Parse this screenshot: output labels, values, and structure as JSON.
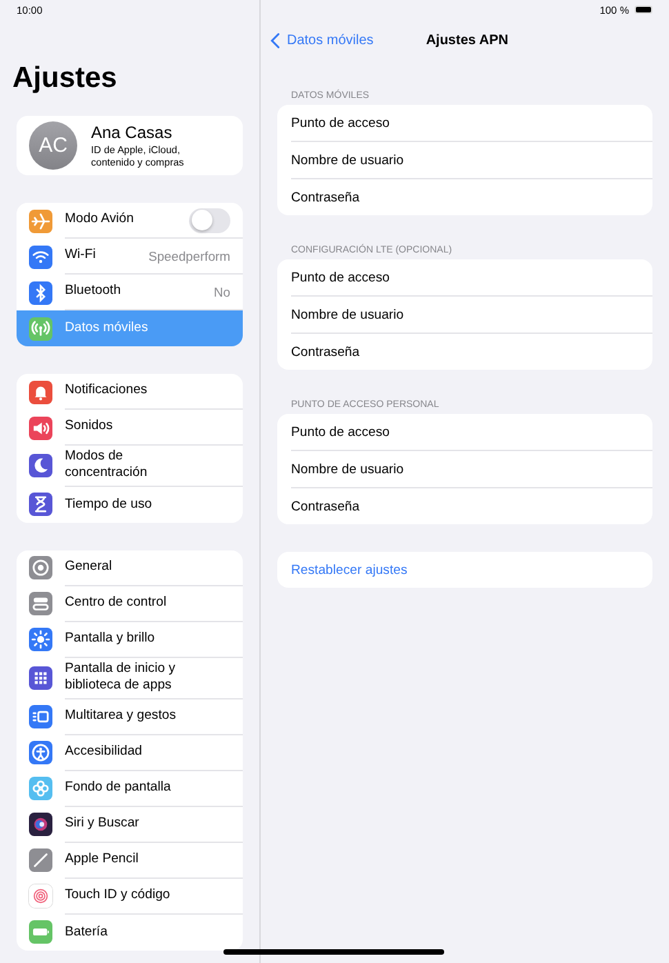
{
  "status_bar": {
    "time": "10:00",
    "battery": "100 %"
  },
  "sidebar": {
    "title": "Ajustes",
    "profile": {
      "initials": "AC",
      "name": "Ana Casas",
      "subtitle": "ID de Apple, iCloud, contenido y compras"
    },
    "groups": [
      [
        {
          "label": "Modo Avión",
          "kind": "toggle",
          "on": false,
          "selected": false
        },
        {
          "label": "Wi-Fi",
          "kind": "value",
          "value": "Speedperform",
          "selected": false
        },
        {
          "label": "Bluetooth",
          "kind": "value",
          "value": "No",
          "selected": false
        },
        {
          "label": "Datos móviles",
          "kind": "plain",
          "selected": true
        }
      ],
      [
        {
          "label": "Notificaciones",
          "kind": "plain",
          "selected": false
        },
        {
          "label": "Sonidos",
          "kind": "plain",
          "selected": false
        },
        {
          "label": "Modos de concentración",
          "kind": "plain",
          "selected": false
        },
        {
          "label": "Tiempo de uso",
          "kind": "plain",
          "selected": false
        }
      ],
      [
        {
          "label": "General",
          "kind": "plain",
          "selected": false
        },
        {
          "label": "Centro de control",
          "kind": "plain",
          "selected": false
        },
        {
          "label": "Pantalla y brillo",
          "kind": "plain",
          "selected": false
        },
        {
          "label": "Pantalla de inicio y biblioteca de apps",
          "kind": "plain",
          "selected": false
        },
        {
          "label": "Multitarea y gestos",
          "kind": "plain",
          "selected": false
        },
        {
          "label": "Accesibilidad",
          "kind": "plain",
          "selected": false
        },
        {
          "label": "Fondo de pantalla",
          "kind": "plain",
          "selected": false
        },
        {
          "label": "Siri y Buscar",
          "kind": "plain",
          "selected": false
        },
        {
          "label": "Apple Pencil",
          "kind": "plain",
          "selected": false
        },
        {
          "label": "Touch ID y código",
          "kind": "plain",
          "selected": false
        },
        {
          "label": "Batería",
          "kind": "plain",
          "selected": false
        }
      ]
    ]
  },
  "detail": {
    "back": "Datos móviles",
    "title": "Ajustes APN",
    "sections": [
      {
        "header": "DATOS MÓVILES",
        "rows": [
          "Punto de acceso",
          "Nombre de usuario",
          "Contraseña"
        ]
      },
      {
        "header": "CONFIGURACIÓN LTE (OPCIONAL)",
        "rows": [
          "Punto de acceso",
          "Nombre de usuario",
          "Contraseña"
        ]
      },
      {
        "header": "PUNTO DE ACCESO PERSONAL",
        "rows": [
          "Punto de acceso",
          "Nombre de usuario",
          "Contraseña"
        ]
      }
    ],
    "reset": "Restablecer ajustes"
  }
}
